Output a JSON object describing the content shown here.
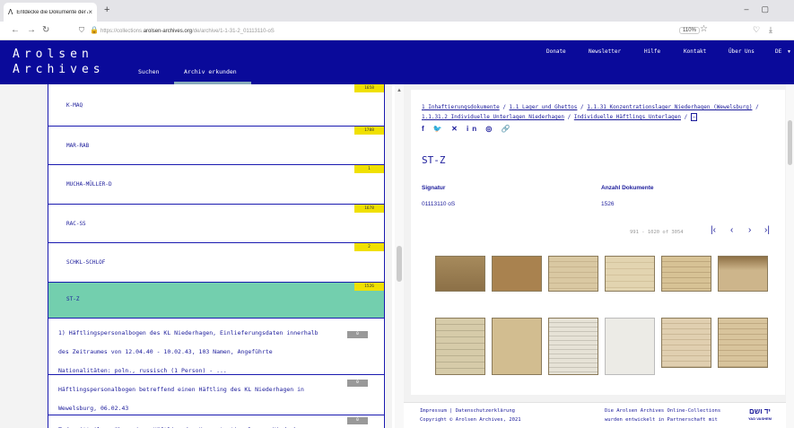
{
  "browser": {
    "tab_title": "Entdecke die Dokumente der A...",
    "url_prefix": "https://collections.",
    "url_domain": "arolsen-archives.org",
    "url_path": "/de/archive/1-1-31-2_01113110-oS",
    "zoom": "110%"
  },
  "site": {
    "logo_line1": "Arolsen",
    "logo_line2": "Archives",
    "nav": {
      "suchen": "Suchen",
      "archiv": "Archiv erkunden"
    },
    "topnav": [
      "Donate",
      "Newsletter",
      "Hilfe",
      "Kontakt",
      "Über Uns",
      "DE"
    ]
  },
  "list": {
    "rows": [
      {
        "label": "K-MAQ",
        "count": "1658"
      },
      {
        "label": "MAR-RAB",
        "count": "1788"
      },
      {
        "label": "MUCHA-MÜLLER-D",
        "count": "1"
      },
      {
        "label": "RAC-SS",
        "count": "1678"
      },
      {
        "label": "SCHKL-SCHLOF",
        "count": "2"
      },
      {
        "label": "ST-Z",
        "count": "1526"
      }
    ],
    "docs": [
      {
        "lines": [
          "1) Häftlingspersonalbogen des KL Niederhagen, Einlieferungsdaten innerhalb",
          "des Zeitraumes von 12.04.40 - 10.02.43, 103 Namen, Angeführte",
          "Nationalitäten: poln., russisch (1 Person) - ..."
        ],
        "count": "0"
      },
      {
        "lines": [
          "Häftlingspersonalbogen betreffend einen Häftling des KL Niederhagen in",
          "Wewelsburg, 06.02.43"
        ],
        "count": "0"
      },
      {
        "lines": [
          "Todesmitteilung über einen Häftling des Konzentrationslagers Niederhagen"
        ],
        "count": "0"
      }
    ]
  },
  "detail": {
    "breadcrumb": [
      "1 Inhaftierungsdokumente",
      "1.1 Lager und Ghettos",
      "1.1.31 Konzentrationslager Niederhagen (Wewelsburg)",
      "1.1.31.2 Individuelle Unterlagen Niederhagen",
      "Individuelle Häftlings Unterlagen"
    ],
    "share_icons": "f 🐦 ✕ in ◎ 🔗",
    "title": "ST-Z",
    "signatur_label": "Signatur",
    "signatur_value": "01113110 oS",
    "anzahl_label": "Anzahl Dokumente",
    "anzahl_value": "1526",
    "paging": "991 - 1020 of 3054"
  },
  "footer": {
    "links": "Impressum  |  Datenschutzerklärung",
    "copyright": "Copyright © Arolsen Archives, 2021",
    "info1": "Die Arolsen Archives Online-Collections",
    "info2": "wurden entwickelt in Partnerschaft mit",
    "yad_logo": "יד ושם",
    "yad_sub": "YAD VASHEM"
  }
}
